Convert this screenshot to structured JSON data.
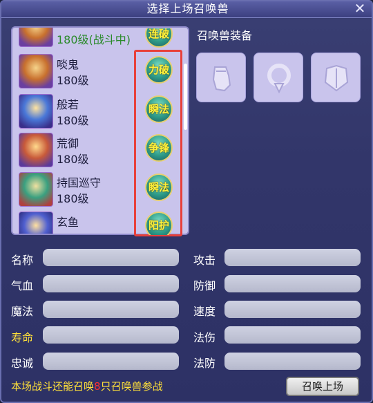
{
  "window": {
    "title": "选择上场召唤兽",
    "close_label": "✕"
  },
  "pets": [
    {
      "name": "",
      "level": "180级(战斗中)",
      "fighting": true,
      "skill": "连破"
    },
    {
      "name": "啖鬼",
      "level": "180级",
      "fighting": false,
      "skill": "力破"
    },
    {
      "name": "般若",
      "level": "180级",
      "fighting": false,
      "skill": "瞬法"
    },
    {
      "name": "荒御",
      "level": "180级",
      "fighting": false,
      "skill": "争锋"
    },
    {
      "name": "持国巡守",
      "level": "180级",
      "fighting": false,
      "skill": "瞬法"
    },
    {
      "name": "玄鱼",
      "level": "",
      "fighting": false,
      "skill": "阳护"
    }
  ],
  "equipment": {
    "title": "召唤兽装备",
    "slots": [
      {
        "icon": "gauntlet-icon"
      },
      {
        "icon": "collar-icon"
      },
      {
        "icon": "armor-icon"
      }
    ]
  },
  "attributes": {
    "name_label": "名称",
    "hp_label": "气血",
    "mp_label": "魔法",
    "life_label": "寿命",
    "loyalty_label": "忠诚",
    "attack_label": "攻击",
    "defense_label": "防御",
    "speed_label": "速度",
    "magic_damage_label": "法伤",
    "magic_defense_label": "法防"
  },
  "footer": {
    "text_before": "本场战斗还能召唤",
    "count": "8",
    "text_after": "只召唤兽参战",
    "summon_button": "召唤上场"
  },
  "colors": {
    "highlight_yellow": "#ffe03a",
    "skill_text": "#fff23a",
    "skill_box_border": "#e8403a"
  }
}
